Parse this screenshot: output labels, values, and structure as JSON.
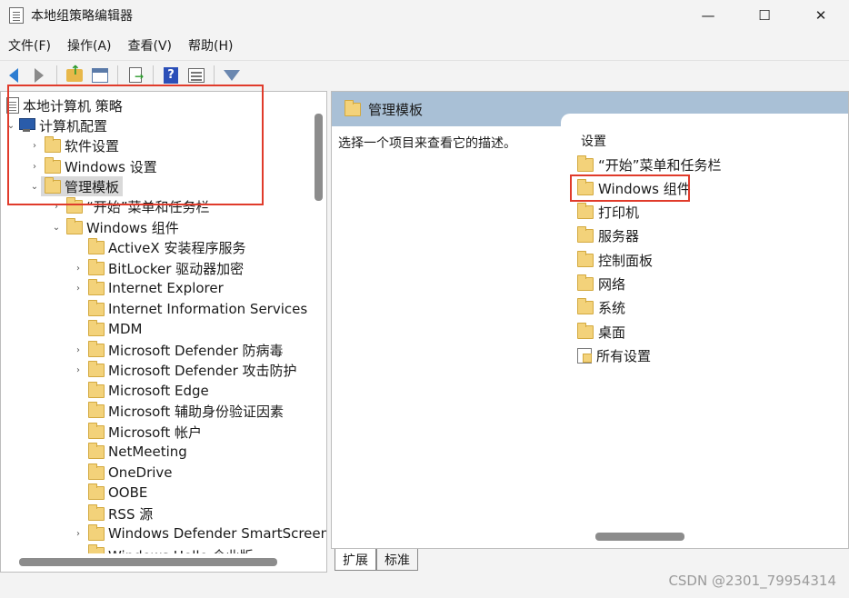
{
  "window": {
    "title": "本地组策略编辑器",
    "controls": {
      "minimize": "—",
      "maximize": "☐",
      "close": "✕"
    }
  },
  "menu": [
    "文件(F)",
    "操作(A)",
    "查看(V)",
    "帮助(H)"
  ],
  "toolbar": {
    "buttons": [
      "back",
      "forward",
      "up",
      "show-hide-tree",
      "export-list",
      "help",
      "properties",
      "filter"
    ]
  },
  "tree": {
    "items": [
      {
        "label": "本地计算机 策略",
        "expander": "",
        "icon": "document-icon"
      },
      {
        "label": "计算机配置",
        "expander": "⌄",
        "icon": "computer-icon"
      },
      {
        "label": "软件设置",
        "expander": "›",
        "icon": "folder-icon"
      },
      {
        "label": "Windows 设置",
        "expander": "›",
        "icon": "folder-icon"
      },
      {
        "label": "管理模板",
        "expander": "⌄",
        "icon": "folder-icon",
        "selected": true
      },
      {
        "label": "“开始”菜单和任务栏",
        "expander": "›",
        "icon": "folder-icon"
      },
      {
        "label": "Windows 组件",
        "expander": "⌄",
        "icon": "folder-icon"
      },
      {
        "label": "ActiveX 安装程序服务",
        "expander": "",
        "icon": "folder-icon"
      },
      {
        "label": "BitLocker 驱动器加密",
        "expander": "›",
        "icon": "folder-icon"
      },
      {
        "label": "Internet Explorer",
        "expander": "›",
        "icon": "folder-icon"
      },
      {
        "label": "Internet Information Services",
        "expander": "",
        "icon": "folder-icon"
      },
      {
        "label": "MDM",
        "expander": "",
        "icon": "folder-icon"
      },
      {
        "label": "Microsoft Defender 防病毒",
        "expander": "›",
        "icon": "folder-icon"
      },
      {
        "label": "Microsoft Defender 攻击防护",
        "expander": "›",
        "icon": "folder-icon"
      },
      {
        "label": "Microsoft Edge",
        "expander": "",
        "icon": "folder-icon"
      },
      {
        "label": "Microsoft 辅助身份验证因素",
        "expander": "",
        "icon": "folder-icon"
      },
      {
        "label": "Microsoft 帐户",
        "expander": "",
        "icon": "folder-icon"
      },
      {
        "label": "NetMeeting",
        "expander": "",
        "icon": "folder-icon"
      },
      {
        "label": "OneDrive",
        "expander": "",
        "icon": "folder-icon"
      },
      {
        "label": "OOBE",
        "expander": "",
        "icon": "folder-icon"
      },
      {
        "label": "RSS 源",
        "expander": "",
        "icon": "folder-icon"
      },
      {
        "label": "Windows Defender SmartScreen",
        "expander": "›",
        "icon": "folder-icon"
      },
      {
        "label": "Windows Hello 企业版",
        "expander": "",
        "icon": "folder-icon"
      }
    ]
  },
  "right": {
    "header": "管理模板",
    "description": "选择一个项目来查看它的描述。",
    "column_header": "设置",
    "items": [
      {
        "label": "“开始”菜单和任务栏",
        "icon": "folder-icon"
      },
      {
        "label": "Windows 组件",
        "icon": "folder-icon"
      },
      {
        "label": "打印机",
        "icon": "folder-icon"
      },
      {
        "label": "服务器",
        "icon": "folder-icon"
      },
      {
        "label": "控制面板",
        "icon": "folder-icon"
      },
      {
        "label": "网络",
        "icon": "folder-icon"
      },
      {
        "label": "系统",
        "icon": "folder-icon"
      },
      {
        "label": "桌面",
        "icon": "folder-icon"
      },
      {
        "label": "所有设置",
        "icon": "settings-icon"
      }
    ]
  },
  "tabs": [
    "扩展",
    "标准"
  ],
  "watermark": "CSDN @2301_79954314",
  "colors": {
    "highlight": "#e03b2b",
    "header_bg": "#a9c0d6",
    "folder": "#f3d27a"
  }
}
